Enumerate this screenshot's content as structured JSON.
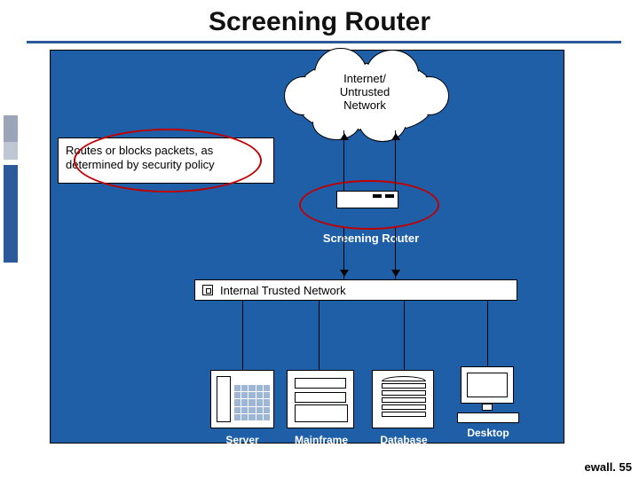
{
  "title": "Screening Router",
  "diagram": {
    "cloud_label_line1": "Internet/",
    "cloud_label_line2": "Untrusted",
    "cloud_label_line3": "Network",
    "description": "Routes or blocks packets, as determined by security policy",
    "router_label": "Screening Router",
    "trusted_network_label": "Internal Trusted Network",
    "devices": {
      "server": "Server",
      "mainframe": "Mainframe",
      "database": "Database",
      "desktop": "Desktop"
    }
  },
  "footer": "ewall. 55"
}
